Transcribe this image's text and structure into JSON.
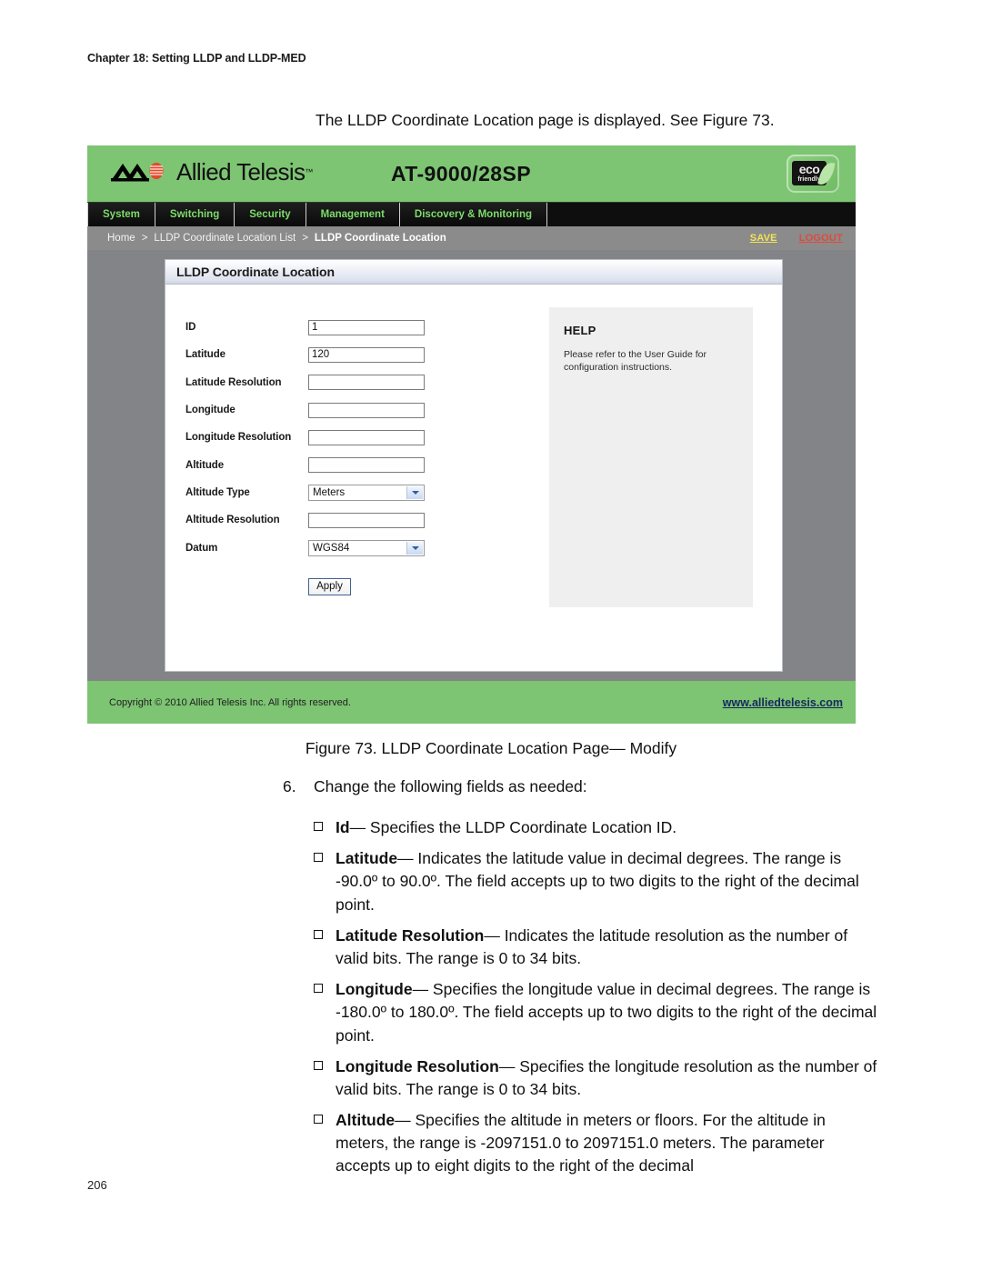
{
  "page": {
    "running_head": "Chapter 18: Setting LLDP and LLDP-MED",
    "intro_line": "The LLDP Coordinate Location page is displayed. See Figure 73.",
    "figure_caption": "Figure 73. LLDP Coordinate Location Page— Modify",
    "page_number": "206"
  },
  "step": {
    "number": "6.",
    "text": "Change the following fields as needed:"
  },
  "bullets": [
    {
      "term": "Id",
      "description": "— Specifies the LLDP Coordinate Location ID."
    },
    {
      "term": "Latitude",
      "description": "— Indicates the latitude value in decimal degrees. The range is -90.0º to 90.0º. The field accepts up to two digits to the right of the decimal point."
    },
    {
      "term": "Latitude Resolution",
      "description": "— Indicates the latitude resolution as the number of valid bits. The range is 0 to 34 bits."
    },
    {
      "term": "Longitude",
      "description": "— Specifies the longitude value in decimal degrees. The range is -180.0º to 180.0º. The field accepts up to two digits to the right of the decimal point."
    },
    {
      "term": "Longitude Resolution",
      "description": "— Specifies the longitude resolution as the number of valid bits. The range is 0 to 34 bits."
    },
    {
      "term": "Altitude",
      "description": "— Specifies the altitude in meters or floors. For the altitude in meters, the range is -2097151.0 to 2097151.0 meters. The parameter accepts up to eight digits to the right of the decimal"
    }
  ],
  "device_ui": {
    "brand": {
      "name": "Allied Telesis",
      "trademark": "™",
      "logo_icon": "allied-telesis-logo"
    },
    "model": "AT-9000/28SP",
    "eco_badge": {
      "top": "eco",
      "bottom": "friendly",
      "icon": "leaf-icon"
    },
    "nav_tabs": [
      "System",
      "Switching",
      "Security",
      "Management",
      "Discovery & Monitoring"
    ],
    "breadcrumb": {
      "items": [
        "Home",
        "LLDP Coordinate Location List"
      ],
      "separator": ">",
      "current": "LLDP Coordinate Location",
      "save_label": "SAVE",
      "logout_label": "LOGOUT"
    },
    "panel": {
      "title": "LLDP Coordinate Location",
      "fields": [
        {
          "label": "ID",
          "type": "text",
          "value": "1",
          "name": "id"
        },
        {
          "label": "Latitude",
          "type": "text",
          "value": "120",
          "name": "latitude"
        },
        {
          "label": "Latitude Resolution",
          "type": "text",
          "value": "",
          "name": "latitude-resolution"
        },
        {
          "label": "Longitude",
          "type": "text",
          "value": "",
          "name": "longitude"
        },
        {
          "label": "Longitude Resolution",
          "type": "text",
          "value": "",
          "name": "longitude-resolution"
        },
        {
          "label": "Altitude",
          "type": "text",
          "value": "",
          "name": "altitude"
        },
        {
          "label": "Altitude Type",
          "type": "select",
          "value": "Meters",
          "name": "altitude-type"
        },
        {
          "label": "Altitude Resolution",
          "type": "text",
          "value": "",
          "name": "altitude-resolution"
        },
        {
          "label": "Datum",
          "type": "select",
          "value": "WGS84",
          "name": "datum"
        }
      ],
      "apply_label": "Apply",
      "help": {
        "title": "HELP",
        "text": "Please refer to the User Guide for configuration instructions."
      }
    },
    "footer": {
      "copyright": "Copyright © 2010 Allied Telesis Inc. All rights reserved.",
      "website": "www.alliedtelesis.com"
    },
    "colors": {
      "banner_green": "#7dc473",
      "nav_black": "#0e0e0e",
      "nav_text_green": "#7ddc6b",
      "breadcrumb_gray": "#8b8b8b",
      "body_gray": "#828487",
      "save_yellow": "#f2e453",
      "logout_red": "#e04a3c"
    }
  }
}
